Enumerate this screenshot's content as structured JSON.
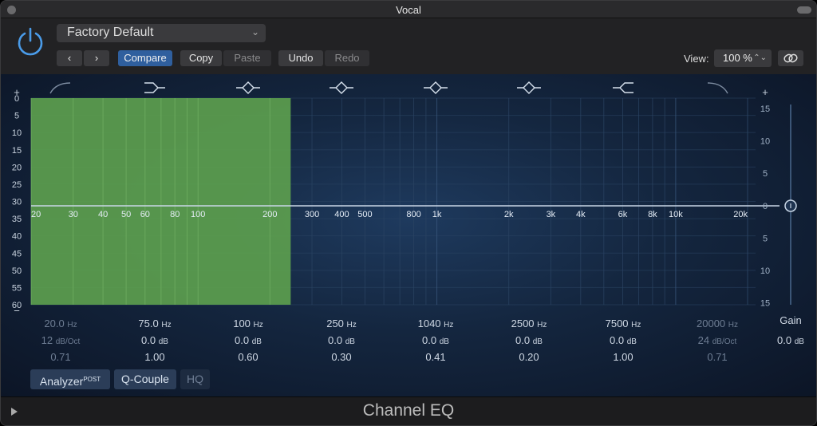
{
  "window": {
    "title": "Vocal"
  },
  "header": {
    "preset": "Factory Default",
    "compare_label": "Compare",
    "copy_label": "Copy",
    "paste_label": "Paste",
    "undo_label": "Undo",
    "redo_label": "Redo",
    "view_label": "View:",
    "view_value": "100 %"
  },
  "eq": {
    "left_scale_plus": "+",
    "left_scale_minus": "−",
    "left_scale": [
      "0",
      "5",
      "10",
      "15",
      "20",
      "25",
      "30",
      "35",
      "40",
      "45",
      "50",
      "55",
      "60"
    ],
    "right_scale_plus": "+",
    "right_scale": [
      "15",
      "10",
      "5",
      "0",
      "5",
      "10",
      "15"
    ],
    "freq_labels": [
      "20",
      "30",
      "40",
      "50",
      "60",
      "80",
      "100",
      "200",
      "300",
      "400",
      "500",
      "800",
      "1k",
      "2k",
      "3k",
      "4k",
      "6k",
      "8k",
      "10k",
      "20k"
    ],
    "gain_label": "Gain",
    "gain_value": "0.0",
    "gain_unit": "dB"
  },
  "bands": [
    {
      "freq": "20.0",
      "freq_unit": "Hz",
      "gain": "12",
      "gain_unit": "dB/Oct",
      "q": "0.71",
      "active": false
    },
    {
      "freq": "75.0",
      "freq_unit": "Hz",
      "gain": "0.0",
      "gain_unit": "dB",
      "q": "1.00",
      "active": true
    },
    {
      "freq": "100",
      "freq_unit": "Hz",
      "gain": "0.0",
      "gain_unit": "dB",
      "q": "0.60",
      "active": true
    },
    {
      "freq": "250",
      "freq_unit": "Hz",
      "gain": "0.0",
      "gain_unit": "dB",
      "q": "0.30",
      "active": true
    },
    {
      "freq": "1040",
      "freq_unit": "Hz",
      "gain": "0.0",
      "gain_unit": "dB",
      "q": "0.41",
      "active": true
    },
    {
      "freq": "2500",
      "freq_unit": "Hz",
      "gain": "0.0",
      "gain_unit": "dB",
      "q": "0.20",
      "active": true
    },
    {
      "freq": "7500",
      "freq_unit": "Hz",
      "gain": "0.0",
      "gain_unit": "dB",
      "q": "1.00",
      "active": true
    },
    {
      "freq": "20000",
      "freq_unit": "Hz",
      "gain": "24",
      "gain_unit": "dB/Oct",
      "q": "0.71",
      "active": false
    }
  ],
  "band_icons": [
    "low-cut-icon",
    "low-shelf-icon",
    "peak-icon",
    "peak-icon",
    "peak-icon",
    "peak-icon",
    "high-shelf-icon",
    "high-cut-icon"
  ],
  "controls": {
    "analyzer_label": "Analyzer",
    "analyzer_mode": "POST",
    "qcouple_label": "Q-Couple",
    "hq_label": "HQ"
  },
  "footer": {
    "plugin_name": "Channel EQ"
  },
  "colors": {
    "accent": "#2f5f9e",
    "analyzer_fill": "#5c9e4e",
    "power": "#4a9be8"
  }
}
